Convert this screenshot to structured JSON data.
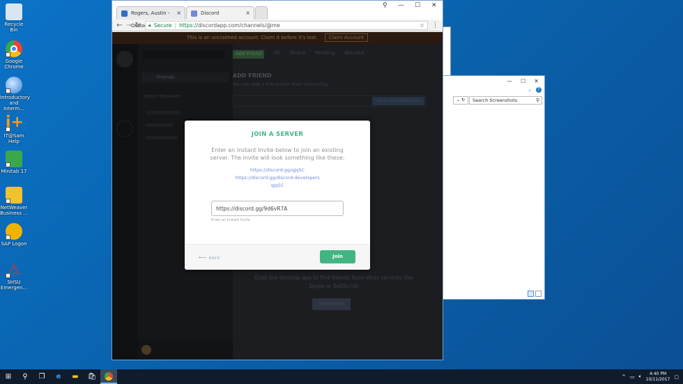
{
  "desktop": {
    "icons": [
      {
        "label": "Recycle Bin",
        "color": "#d9e6f2"
      },
      {
        "label": "Google\nChrome",
        "color": "#e8453c"
      },
      {
        "label": "Introductory\nand Interm...",
        "color": "#5ea0e0"
      },
      {
        "label": "IT@Sam Help",
        "color": "#f29a1f"
      },
      {
        "label": "Minitab 17",
        "color": "#3aa84a"
      },
      {
        "label": "NetWeaver\nBusiness ...",
        "color": "#f2c12e"
      },
      {
        "label": "SAP Logon",
        "color": "#f0b400"
      },
      {
        "label": "SHSU\nEmergen...",
        "color": "#e0332a"
      }
    ]
  },
  "explorer": {
    "search_placeholder": "Search Screenshots",
    "minimize": "—",
    "maximize": "☐",
    "close": "✕"
  },
  "chrome": {
    "tabs": [
      {
        "label": "Rogers, Austin - Outlook",
        "icon_color": "#2f6fc4"
      },
      {
        "label": "Discord",
        "icon_color": "#7289da"
      }
    ],
    "close_glyph": "×",
    "window": {
      "profile": "⚲",
      "minimize": "—",
      "maximize": "☐",
      "close": "✕"
    },
    "url": {
      "secure_label": "Secure",
      "scheme": "https://",
      "rest": "discordapp.com/channels/@me"
    }
  },
  "discord": {
    "banner": {
      "text": "This is an unclaimed account. Claim it before it's lost.",
      "button": "Claim Account"
    },
    "sidebar": {
      "friends_label": "Friends",
      "dm_label": "DIRECT MESSAGES"
    },
    "main": {
      "tabs": [
        "Add Friend",
        "All",
        "Online",
        "Pending",
        "Blocked"
      ],
      "add_friend_title": "ADD FRIEND",
      "add_friend_sub": "You can add a friend with their DiscordTag.",
      "send_button": "Send Friend Request",
      "download_text": "Grab the desktop app to find friends from other services like Skype or Battle.net",
      "download_button": "Download"
    }
  },
  "modal": {
    "title": "JOIN A SERVER",
    "description": "Enter an Instant Invite below to join an existing server. The invite will look something like these:",
    "examples": [
      "https://discord.gg/qJq5C",
      "https://discord.gg/discord-developers",
      "qJq5C"
    ],
    "input_value": "https://discord.gg/9d6vR7A",
    "input_hint": "Enter an Instant Invite",
    "back_label": "BACK",
    "join_label": "Join",
    "accent": "#43b581"
  },
  "taskbar": {
    "time": "4:40 PM",
    "date": "10/11/2017"
  }
}
